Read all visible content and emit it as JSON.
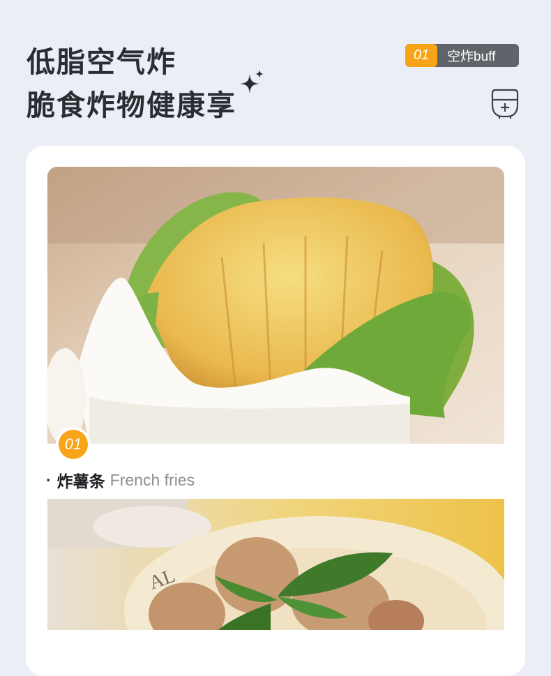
{
  "header": {
    "title_line1": "低脂空气炸",
    "title_line2": "脆食炸物健康享"
  },
  "tag": {
    "number": "01",
    "text": "空炸buff"
  },
  "items": [
    {
      "badge": "01",
      "bullet": "·",
      "name_zh": "炸薯条",
      "name_en": "French fries"
    }
  ],
  "colors": {
    "background": "#eceef6",
    "accent": "#f7a418",
    "tag_gray": "#5e6469",
    "title": "#2b2d33"
  },
  "icons": [
    "sparkle-icon",
    "air-fryer-icon"
  ]
}
